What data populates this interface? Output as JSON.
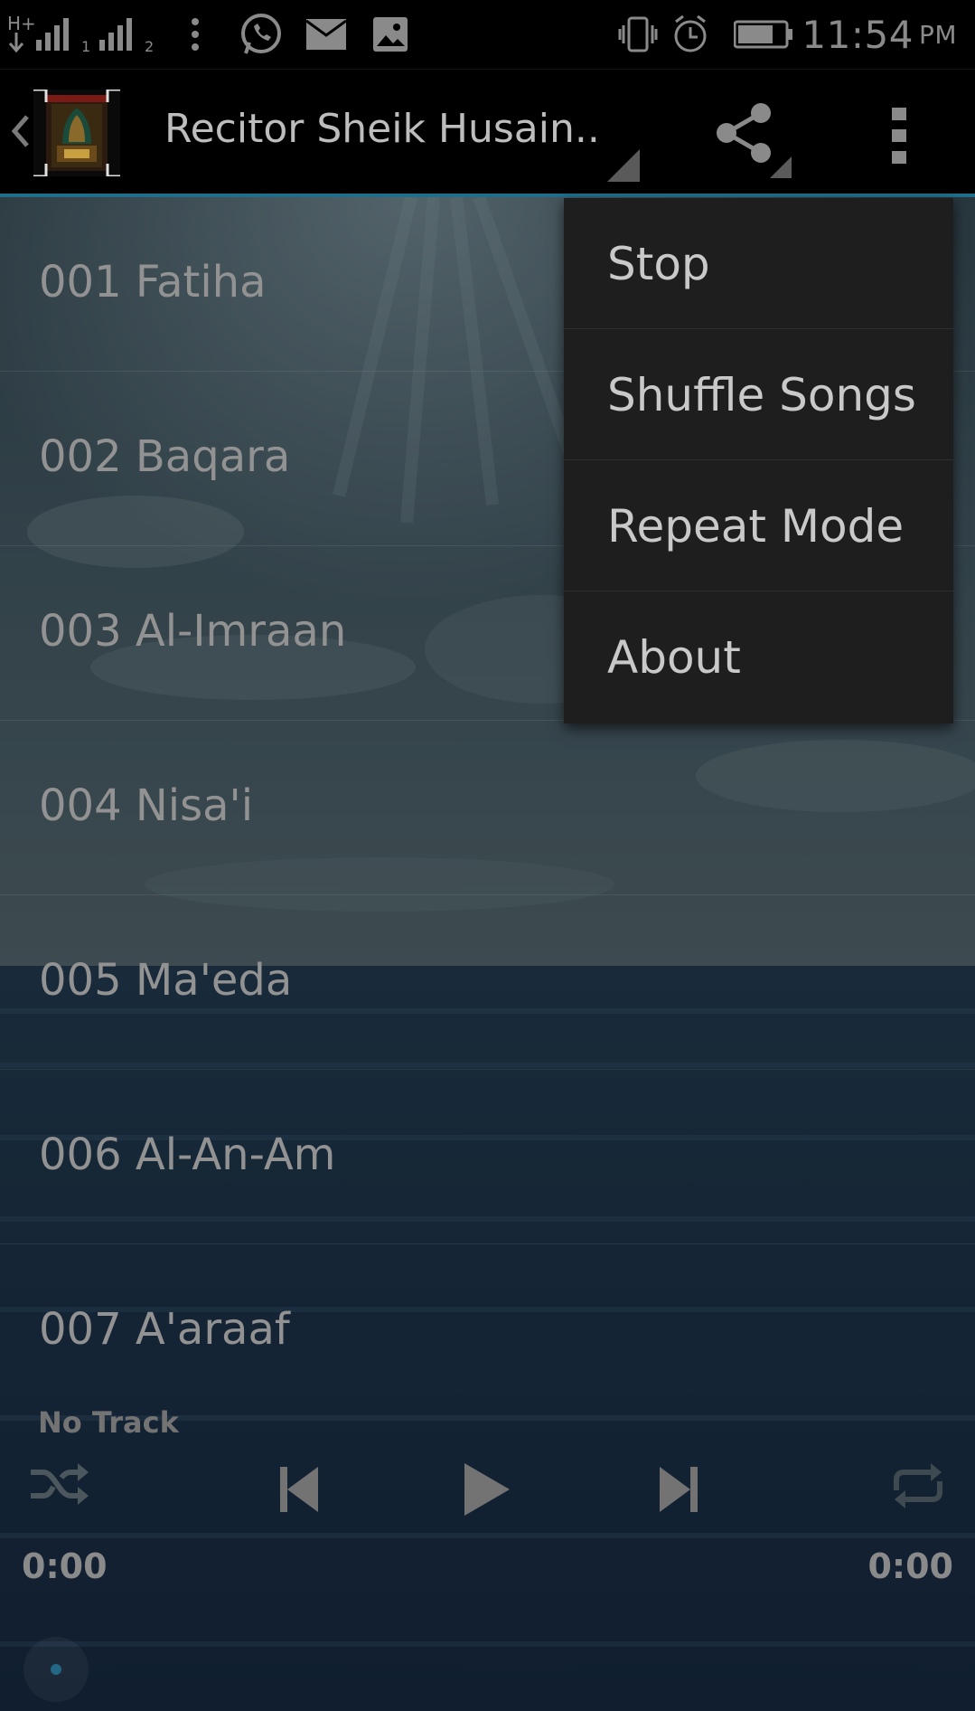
{
  "status_bar": {
    "network_label": "H+",
    "sim1": "1",
    "sim2": "2",
    "time": "11:54",
    "ampm": "PM",
    "icons": [
      "signal-icon",
      "overflow-dots-icon",
      "whatsapp-icon",
      "mail-icon",
      "image-icon",
      "vibrate-icon",
      "alarm-icon",
      "battery-icon"
    ]
  },
  "action_bar": {
    "title": "Recitor Sheik Husain..",
    "actions": [
      "share-icon",
      "overflow-menu-icon"
    ]
  },
  "tracks": [
    {
      "label": "001 Fatiha"
    },
    {
      "label": "002 Baqara"
    },
    {
      "label": "003 Al-Imraan"
    },
    {
      "label": "004 Nisa'i"
    },
    {
      "label": "005 Ma'eda"
    },
    {
      "label": "006 Al-An-Am"
    },
    {
      "label": "007 A'araaf"
    }
  ],
  "player": {
    "now_playing": "No Track",
    "elapsed": "0:00",
    "duration": "0:00",
    "progress": 0,
    "controls": [
      "shuffle-icon",
      "previous-icon",
      "play-icon",
      "next-icon",
      "repeat-icon"
    ]
  },
  "menu": {
    "items": [
      {
        "label": "Stop"
      },
      {
        "label": "Shuffle Songs"
      },
      {
        "label": "Repeat Mode"
      },
      {
        "label": "About"
      }
    ]
  },
  "colors": {
    "accent": "#1f6f8b",
    "menu_bg": "#1e1e1e",
    "status_bar_bg": "#000000"
  }
}
